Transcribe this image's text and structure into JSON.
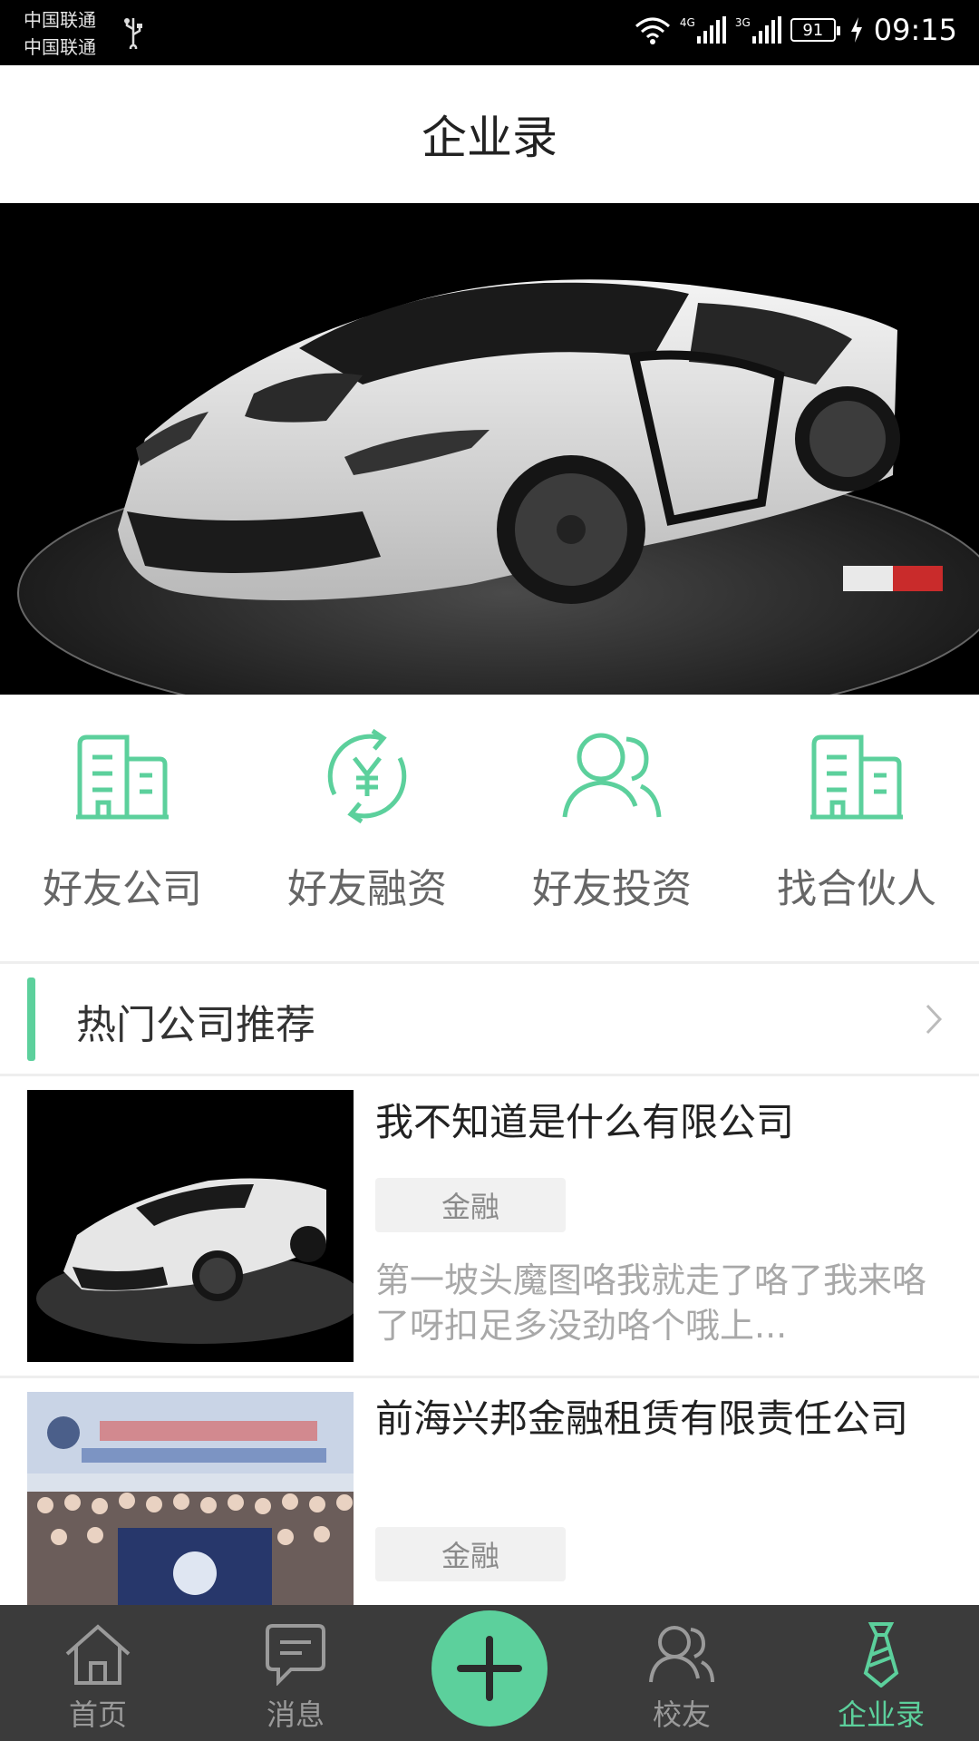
{
  "status_bar": {
    "carrier_1": "中国联通",
    "carrier_2": "中国联通",
    "network_1": "4G",
    "network_2": "3G",
    "battery": "91",
    "time": "09:15"
  },
  "header": {
    "title": "企业录"
  },
  "banner": {
    "image": "white-sports-car-on-turntable"
  },
  "quick_entries": [
    {
      "label": "好友公司",
      "icon": "building-icon"
    },
    {
      "label": "好友融资",
      "icon": "yuan-cycle-icon"
    },
    {
      "label": "好友投资",
      "icon": "users-icon"
    },
    {
      "label": "找合伙人",
      "icon": "building-icon"
    }
  ],
  "section": {
    "title": "热门公司推荐"
  },
  "companies": [
    {
      "name": "我不知道是什么有限公司",
      "tag": "金融",
      "desc": "第一坡头魔图咯我就走了咯了我来咯了呀扣足多没劲咯个哦上...",
      "image": "white-sports-car-thumbnail"
    },
    {
      "name": "前海兴邦金融租赁有限责任公司",
      "tag": "金融",
      "desc": "",
      "image": "group-photo-thumbnail"
    }
  ],
  "bottom_nav": [
    {
      "label": "首页",
      "icon": "home-icon"
    },
    {
      "label": "消息",
      "icon": "message-icon"
    },
    {
      "label": "",
      "icon": "plus-icon"
    },
    {
      "label": "校友",
      "icon": "alumni-icon"
    },
    {
      "label": "企业录",
      "icon": "tie-icon",
      "active": true
    }
  ],
  "colors": {
    "accent": "#5cd09c",
    "nav_bg": "#3b3b3b",
    "inactive": "#9a9a9a"
  }
}
